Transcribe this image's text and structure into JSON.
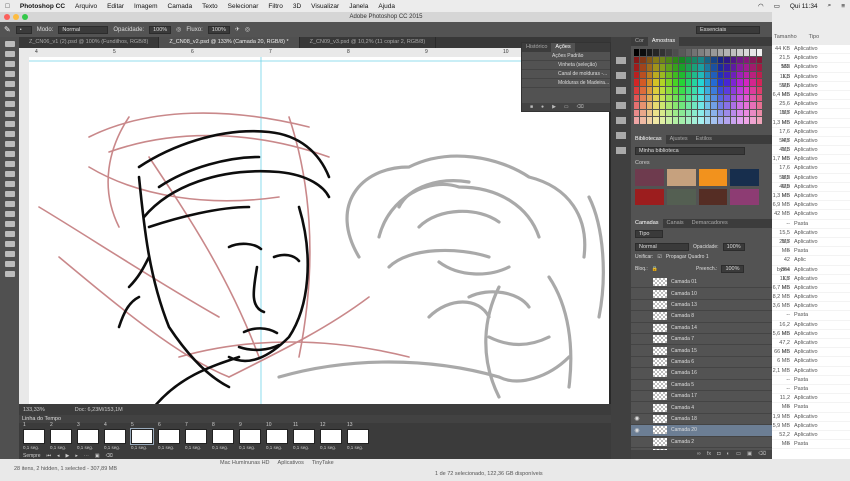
{
  "menubar": {
    "items": [
      "Photoshop CC",
      "Arquivo",
      "Editar",
      "Imagem",
      "Camada",
      "Texto",
      "Selecionar",
      "Filtro",
      "3D",
      "Visualizar",
      "Janela",
      "Ajuda"
    ],
    "clock": "Qui 11:34"
  },
  "window": {
    "title": "Adobe Photoshop CC 2015",
    "workspace": "Essenciais"
  },
  "options": {
    "mode_label": "Modo:",
    "mode_value": "Normal",
    "opacity_label": "Opacidade:",
    "opacity_value": "100%",
    "flow_label": "Fluxo:",
    "flow_value": "100%"
  },
  "doc_tabs": [
    "Z_CN06_v1 (2).psd @ 100% (Fundilhos, RGB/8)",
    "Z_CN08_v2.psd @ 133% (Camada 20, RGB/8) *",
    "Z_CN09_v3.psd @ 10,2% (11 copiar 2, RGB/8)"
  ],
  "ruler": {
    "ticks": [
      "4",
      "5",
      "6",
      "7",
      "8",
      "9",
      "10"
    ]
  },
  "status": {
    "zoom": "133,33%",
    "doc": "Doc: 6,23M/153,1M"
  },
  "history_panel": {
    "tabs": [
      "Histórico",
      "Ações"
    ],
    "rows": [
      "Ações Padrão",
      "Vinheta (seleção)",
      "Canal de molduras -...",
      "Molduras de Madeira..."
    ]
  },
  "timeline": {
    "title": "Linha do Tempo",
    "frames": [
      "1",
      "2",
      "3",
      "4",
      "5",
      "6",
      "7",
      "8",
      "9",
      "10",
      "11",
      "12",
      "13"
    ],
    "duration": "0,1 seg.",
    "loop": "Sempre"
  },
  "color_panel": {
    "tabs": [
      "Cor",
      "Amostras"
    ]
  },
  "libraries": {
    "tabs": [
      "Bibliotecas",
      "Ajustes",
      "Estilos"
    ],
    "library_name": "Minha biblioteca",
    "section": "Cores",
    "colors": [
      "#6e3b4e",
      "#c6a17e",
      "#f2921d",
      "#172e4d",
      "#9c1d1e",
      "#545f52",
      "#552d24",
      "#8d3c73"
    ]
  },
  "layers": {
    "tabs": [
      "Camadas",
      "Canais",
      "Demarcadores"
    ],
    "kind": "Tipo",
    "blend": "Normal",
    "opacity_label": "Opacidade:",
    "opacity_value": "100%",
    "lock_label": "Bloq.:",
    "fill_label": "Preench.:",
    "fill_value": "100%",
    "propagate": "Propagar Quadro 1",
    "unify": "Unificar:",
    "rows": [
      {
        "name": "Camada 01",
        "vis": false,
        "sel": false
      },
      {
        "name": "Camada 10",
        "vis": false,
        "sel": false
      },
      {
        "name": "Camada 13",
        "vis": false,
        "sel": false
      },
      {
        "name": "Camada 8",
        "vis": false,
        "sel": false
      },
      {
        "name": "Camada 14",
        "vis": false,
        "sel": false
      },
      {
        "name": "Camada 7",
        "vis": false,
        "sel": false
      },
      {
        "name": "Camada 15",
        "vis": false,
        "sel": false
      },
      {
        "name": "Camada 6",
        "vis": false,
        "sel": false
      },
      {
        "name": "Camada 16",
        "vis": false,
        "sel": false
      },
      {
        "name": "Camada 5",
        "vis": false,
        "sel": false
      },
      {
        "name": "Camada 17",
        "vis": false,
        "sel": false
      },
      {
        "name": "Camada 4",
        "vis": false,
        "sel": false
      },
      {
        "name": "Camada 18",
        "vis": true,
        "sel": false
      },
      {
        "name": "Camada 20",
        "vis": true,
        "sel": true
      },
      {
        "name": "Camada 2",
        "vis": false,
        "sel": false
      },
      {
        "name": "1",
        "vis": true,
        "sel": false
      }
    ]
  },
  "finder": {
    "col_size": "Tamanho",
    "col_kind": "Tipo",
    "rows": [
      [
        "44 KB",
        "Aplicativo"
      ],
      [
        "21,5 MB",
        "Aplicativo"
      ],
      [
        "552 KB",
        "Aplicativo"
      ],
      [
        "11,3 MB",
        "Aplicativo"
      ],
      [
        "59,6 MB",
        "Aplicativo"
      ],
      [
        "6,4 MB",
        "Aplicativo"
      ],
      [
        "25,6 MB",
        "Aplicativo"
      ],
      [
        "15,7 MB",
        "Aplicativo"
      ],
      [
        "1,3 MB",
        "Aplicativo"
      ],
      [
        "17,6 MB",
        "Aplicativo"
      ],
      [
        "54,7 MB",
        "Aplicativo"
      ],
      [
        "41,3 MB",
        "Aplicativo"
      ],
      [
        "1,7 MB",
        "Aplicativo"
      ],
      [
        "17,6 MB",
        "Aplicativo"
      ],
      [
        "58,2 MB",
        "Aplicativo"
      ],
      [
        "40,9 MB",
        "Aplicativo"
      ],
      [
        "1,3 MB",
        "Aplicativo"
      ],
      [
        "6,9 MB",
        "Aplicativo"
      ],
      [
        "42 MB",
        "Aplicativo"
      ],
      [
        "--",
        "Pasta"
      ],
      [
        "15,5 MB",
        "Aplicativo"
      ],
      [
        "25,7 MB",
        "Aplicativo"
      ],
      [
        "--",
        "Pasta"
      ],
      [
        "42 bytes",
        "Aplic"
      ],
      [
        "864 KB",
        "Aplicativo"
      ],
      [
        "11,7 MB",
        "Aplicativo"
      ],
      [
        "6,7 MB",
        "Aplicativo"
      ],
      [
        "8,2 MB",
        "Aplicativo"
      ],
      [
        "3,6 MB",
        "Aplicativo"
      ],
      [
        "--",
        "Pasta"
      ],
      [
        "16,2 MB",
        "Aplicativo"
      ],
      [
        "5,6 MB",
        "Aplicativo"
      ],
      [
        "47,2 MB",
        "Aplicativo"
      ],
      [
        "66 MB",
        "Aplicativo"
      ],
      [
        "6 MB",
        "Aplicativo"
      ],
      [
        "2,1 MB",
        "Aplicativo"
      ],
      [
        "--",
        "Pasta"
      ],
      [
        "--",
        "Pasta"
      ],
      [
        "11,2 MB",
        "Aplicativo"
      ],
      [
        "--",
        "Pasta"
      ],
      [
        "1,9 MB",
        "Aplicativo"
      ],
      [
        "5,9 MB",
        "Aplicativo"
      ],
      [
        "52,2 MB",
        "Aplicativo"
      ],
      [
        "--",
        "Pasta"
      ]
    ]
  },
  "bottom": {
    "left": "28 itens, 2 hidden, 1 selected - 307,89 MB",
    "path": [
      "Mac Humínunas HD",
      "Aplicativos",
      "TinyTake"
    ],
    "center": "1 de 72 selecionado, 122,36 GB disponíveis"
  }
}
